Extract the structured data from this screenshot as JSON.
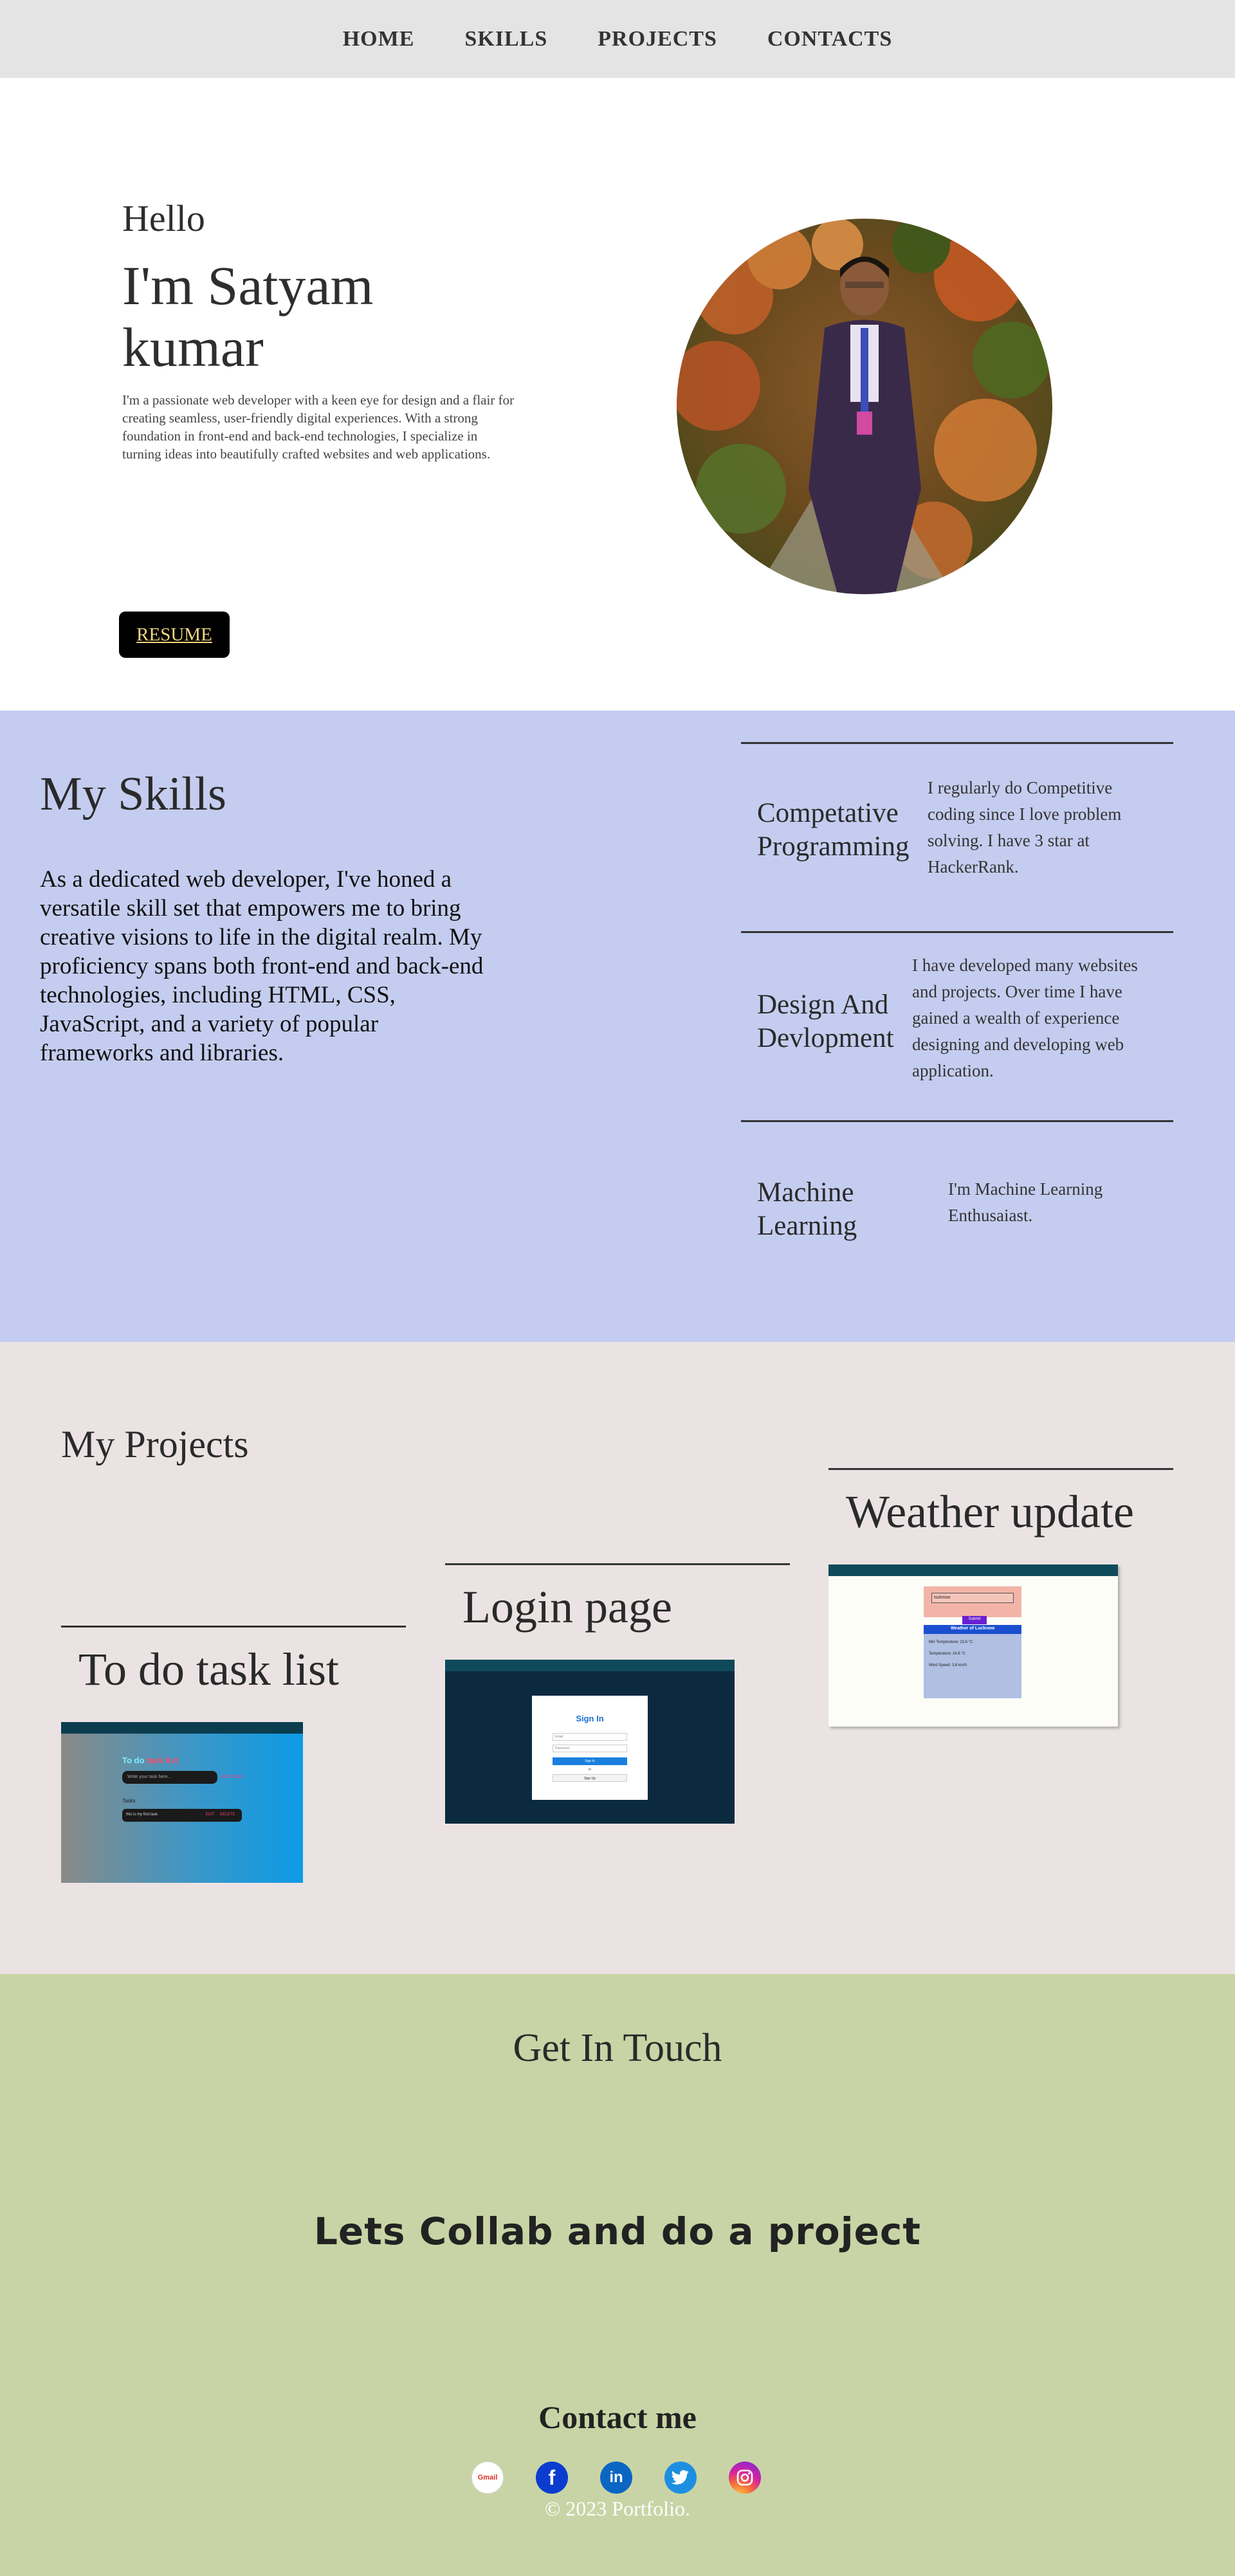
{
  "nav": {
    "items": [
      {
        "label": "HOME"
      },
      {
        "label": "SKILLS"
      },
      {
        "label": "PROJECTS"
      },
      {
        "label": "CONTACTS"
      }
    ]
  },
  "hero": {
    "greeting": "Hello",
    "name": "I'm Satyam kumar",
    "intro": "I'm a passionate web developer with a keen eye for design and a flair for creating seamless, user-friendly digital experiences. With a strong foundation in front-end and back-end technologies, I specialize in turning ideas into beautifully crafted websites and web applications.",
    "resume_label": "RESUME"
  },
  "skills": {
    "title": "My Skills",
    "description": "As a dedicated web developer, I've honed a versatile skill set that empowers me to bring creative visions to life in the digital realm. My proficiency spans both front-end and back-end technologies, including HTML, CSS, JavaScript, and a variety of popular frameworks and libraries.",
    "items": [
      {
        "name": "Competative Programming",
        "text": "I regularly do Competitive coding since I love problem solving. I have 3 star at HackerRank."
      },
      {
        "name": "Design And Devlopment",
        "text": "I have developed many websites and projects. Over time I have gained a wealth of experience designing and developing web application."
      },
      {
        "name": "Machine Learning",
        "text": "I'm Machine Learning Enthusaiast."
      }
    ]
  },
  "projects": {
    "title": "My Projects",
    "items": [
      {
        "title": "To do task list",
        "shot_heading_a": "To do",
        "shot_heading_b": "task list",
        "shot_placeholder": "Write your task here...",
        "shot_add": "ADD TASK",
        "shot_label": "Tasks",
        "shot_task": "this is my first task",
        "shot_edit": "EDIT",
        "shot_delete": "DELETE"
      },
      {
        "title": "Login page",
        "shot_heading": "Sign In",
        "shot_user": "Email",
        "shot_pass": "Password",
        "shot_btn": "Sign In",
        "shot_or": "or",
        "shot_signup": "Sign Up"
      },
      {
        "title": "Weather update",
        "shot_city": "lucknow",
        "shot_submit": "Submit",
        "shot_heading": "Weather of Lucknow",
        "shot_rows": [
          "Min Temperature: 23.6 °C",
          "Temperature: 24.6 °C",
          "Wind Speed: 3.6 km/h"
        ]
      }
    ]
  },
  "contact": {
    "title": "Get In Touch",
    "collab": "Lets Collab and do a project",
    "contact_me": "Contact me",
    "socials": [
      {
        "icon": "gmail-icon",
        "label": "Gmail"
      },
      {
        "icon": "facebook-icon",
        "label": "f"
      },
      {
        "icon": "linkedin-icon",
        "label": "in"
      },
      {
        "icon": "twitter-icon",
        "label": ""
      },
      {
        "icon": "instagram-icon",
        "label": ""
      }
    ],
    "copyright": "© 2023 Portfolio."
  },
  "colors": {
    "nav_bg": "#e4e4e4",
    "skills_bg": "#c4cdef",
    "projects_bg": "#ebe3e3",
    "contact_bg": "#c9d4a6",
    "resume_text": "#f2d57e"
  }
}
